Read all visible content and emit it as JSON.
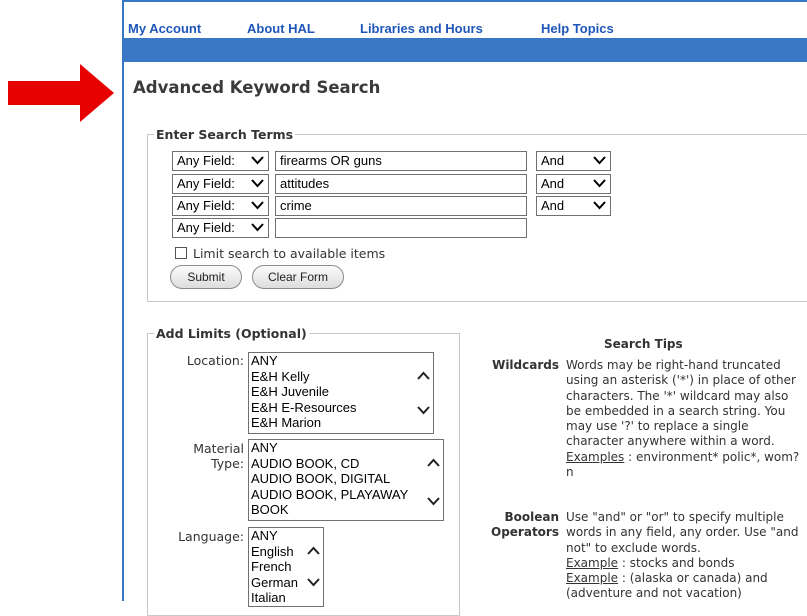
{
  "nav": {
    "items": [
      "My Account",
      "About HAL",
      "Libraries and Hours",
      "Help Topics"
    ]
  },
  "colors": {
    "nav_link": "#1f57b8",
    "bar": "#3a78c6",
    "arrow": "#e60000"
  },
  "title": "Advanced Keyword Search",
  "search_terms": {
    "legend": "Enter Search Terms",
    "rows": [
      {
        "field": "Any Field:",
        "value": "firearms OR guns",
        "op": "And"
      },
      {
        "field": "Any Field:",
        "value": "attitudes",
        "op": "And"
      },
      {
        "field": "Any Field:",
        "value": "crime",
        "op": "And"
      },
      {
        "field": "Any Field:",
        "value": "",
        "op": null
      }
    ],
    "limit_label": "Limit search to available items",
    "limit_checked": false,
    "submit_label": "Submit",
    "clear_label": "Clear Form"
  },
  "limits": {
    "legend": "Add Limits (Optional)",
    "location_label": "Location:",
    "location_options": [
      "ANY",
      "E&H Kelly",
      "E&H Juvenile",
      "E&H E-Resources",
      "E&H Marion"
    ],
    "material_label_1": "Material",
    "material_label_2": "Type:",
    "material_options": [
      "ANY",
      "AUDIO BOOK, CD",
      "AUDIO BOOK, DIGITAL",
      "AUDIO BOOK, PLAYAWAY",
      "BOOK"
    ],
    "language_label": "Language:",
    "language_options": [
      "ANY",
      "English",
      "French",
      "German",
      "Italian"
    ]
  },
  "tips": {
    "title": "Search Tips",
    "wildcards_term": "Wildcards",
    "wildcards_body": "Words may be right-hand truncated using an asterisk ('*') in place of other characters. The '*' wildcard may also be embedded in a search string. You may use '?' to replace a single character anywhere within a word.",
    "wildcards_example_label": "Examples",
    "wildcards_example": ": environment* polic*, wom?n",
    "boolean_term_1": "Boolean",
    "boolean_term_2": "Operators",
    "boolean_body": "Use \"and\" or \"or\" to specify multiple words in any field, any order. Use \"and not\" to exclude words.",
    "example_label": "Example",
    "boolean_example_1": ": stocks and bonds",
    "boolean_example_2": ": (alaska or canada) and (adventure and not vacation)"
  }
}
